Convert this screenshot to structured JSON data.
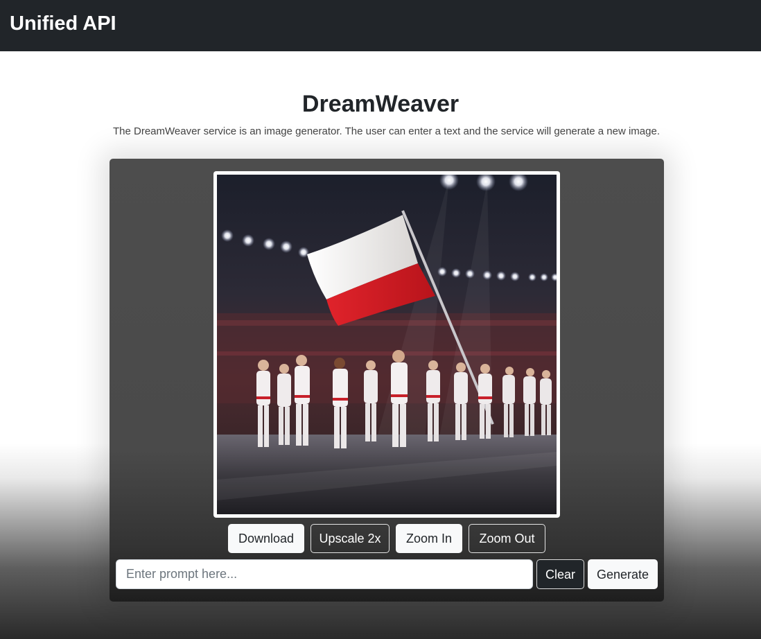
{
  "navbar": {
    "brand": "Unified API"
  },
  "page": {
    "title": "DreamWeaver",
    "description": "The DreamWeaver service is an image generator. The user can enter a text and the service will generate a new image."
  },
  "image_actions": {
    "download_label": "Download",
    "upscale_label": "Upscale 2x",
    "zoom_in_label": "Zoom In",
    "zoom_out_label": "Zoom Out"
  },
  "prompt": {
    "placeholder": "Enter prompt here...",
    "value": "",
    "clear_label": "Clear",
    "generate_label": "Generate"
  },
  "colors": {
    "navbar_bg": "#212529",
    "card_bg": "#4d4d4d",
    "flag_white": "#f2f0ee",
    "flag_red": "#d61a22"
  }
}
